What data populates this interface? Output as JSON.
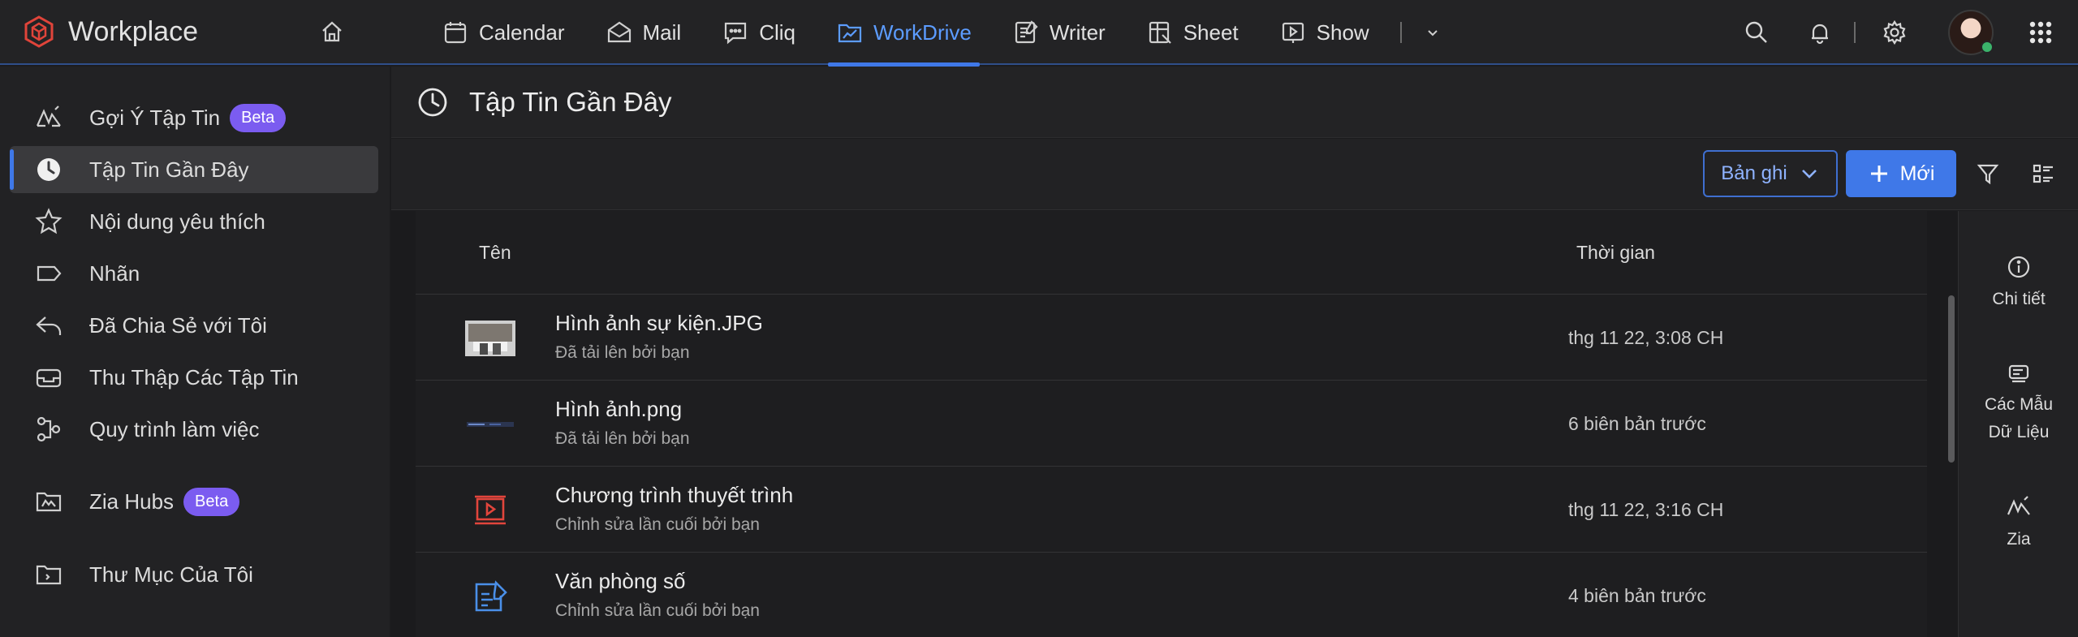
{
  "brand": {
    "name": "Workplace"
  },
  "apps": [
    {
      "label": "Calendar",
      "icon": "calendar-icon"
    },
    {
      "label": "Mail",
      "icon": "mail-icon"
    },
    {
      "label": "Cliq",
      "icon": "chat-icon"
    },
    {
      "label": "WorkDrive",
      "icon": "drive-icon",
      "active": true
    },
    {
      "label": "Writer",
      "icon": "writer-icon"
    },
    {
      "label": "Sheet",
      "icon": "sheet-icon"
    },
    {
      "label": "Show",
      "icon": "show-icon"
    }
  ],
  "sidebar": {
    "items": [
      {
        "label": "Gợi Ý Tập Tin",
        "icon": "zia-icon",
        "badge": "Beta"
      },
      {
        "label": "Tập Tin Gần Đây",
        "icon": "clock-icon",
        "active": true
      },
      {
        "label": "Nội dung yêu thích",
        "icon": "star-icon"
      },
      {
        "label": "Nhãn",
        "icon": "label-icon"
      },
      {
        "label": "Đã Chia Sẻ với Tôi",
        "icon": "share-icon"
      },
      {
        "label": "Thu Thập Các Tập Tin",
        "icon": "inbox-icon"
      },
      {
        "label": "Quy trình làm việc",
        "icon": "workflow-icon"
      },
      {
        "label": "Zia Hubs",
        "icon": "hub-icon",
        "badge": "Beta"
      },
      {
        "label": "Thư Mục Của Tôi",
        "icon": "folder-icon"
      }
    ]
  },
  "page": {
    "title": "Tập Tin Gần Đây"
  },
  "toolbar": {
    "sort_label": "Bản ghi",
    "new_label": "Mới"
  },
  "table": {
    "headers": {
      "name": "Tên",
      "time": "Thời gian"
    },
    "rows": [
      {
        "name": "Hình ảnh sự kiện.JPG",
        "sub": "Đã tải lên bởi bạn",
        "time": "thg 11 22, 3:08 CH",
        "thumb": "photo-thumbnail"
      },
      {
        "name": "Hình ảnh.png",
        "sub": "Đã tải lên bởi bạn",
        "time": "6 biên bản trước",
        "thumb": "image-thumbnail"
      },
      {
        "name": "Chương trình thuyết trình",
        "sub": "Chỉnh sửa lần cuối bởi bạn",
        "time": "thg 11 22, 3:16 CH",
        "thumb": "presentation-icon"
      },
      {
        "name": "Văn phòng số",
        "sub": "Chỉnh sửa lần cuối bởi bạn",
        "time": "4 biên bản trước",
        "thumb": "document-icon"
      }
    ]
  },
  "rpanel": {
    "details": "Chi tiết",
    "templates_line1": "Các Mẫu",
    "templates_line2": "Dữ Liệu",
    "zia": "Zia"
  },
  "colors": {
    "accent": "#3f78e8",
    "beta": "#7b5cf0",
    "brand_red": "#e0443a",
    "presentation_red": "#e2453c",
    "writer_blue": "#4a8fe8"
  }
}
